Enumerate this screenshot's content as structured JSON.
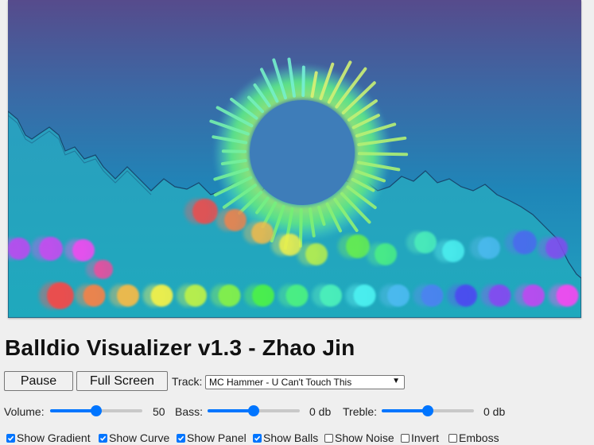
{
  "title": "Balldio Visualizer v1.3 - Zhao Jin",
  "controls": {
    "pause_label": "Pause",
    "fullscreen_label": "Full Screen",
    "track_label": "Track:",
    "track_value": "MC Hammer - U Can't Touch This"
  },
  "sliders": {
    "volume": {
      "label": "Volume:",
      "value": 50,
      "value_text": "50"
    },
    "bass": {
      "label": "Bass:",
      "value": 0,
      "value_text": "0 db"
    },
    "treble": {
      "label": "Treble:",
      "value": 0,
      "value_text": "0 db"
    }
  },
  "options": [
    {
      "label": "Show Gradient",
      "checked": true
    },
    {
      "label": "Show Curve",
      "checked": true
    },
    {
      "label": "Show Panel",
      "checked": true
    },
    {
      "label": "Show Balls",
      "checked": true
    },
    {
      "label": "Show Noise",
      "checked": false
    },
    {
      "label": "Invert",
      "checked": false
    },
    {
      "label": "Emboss",
      "checked": false
    }
  ],
  "colors": {
    "accent": "#0075ff",
    "sky_top": "#554a8c",
    "sky_bottom": "#2a8fbf",
    "ground": "#25a6c0"
  }
}
